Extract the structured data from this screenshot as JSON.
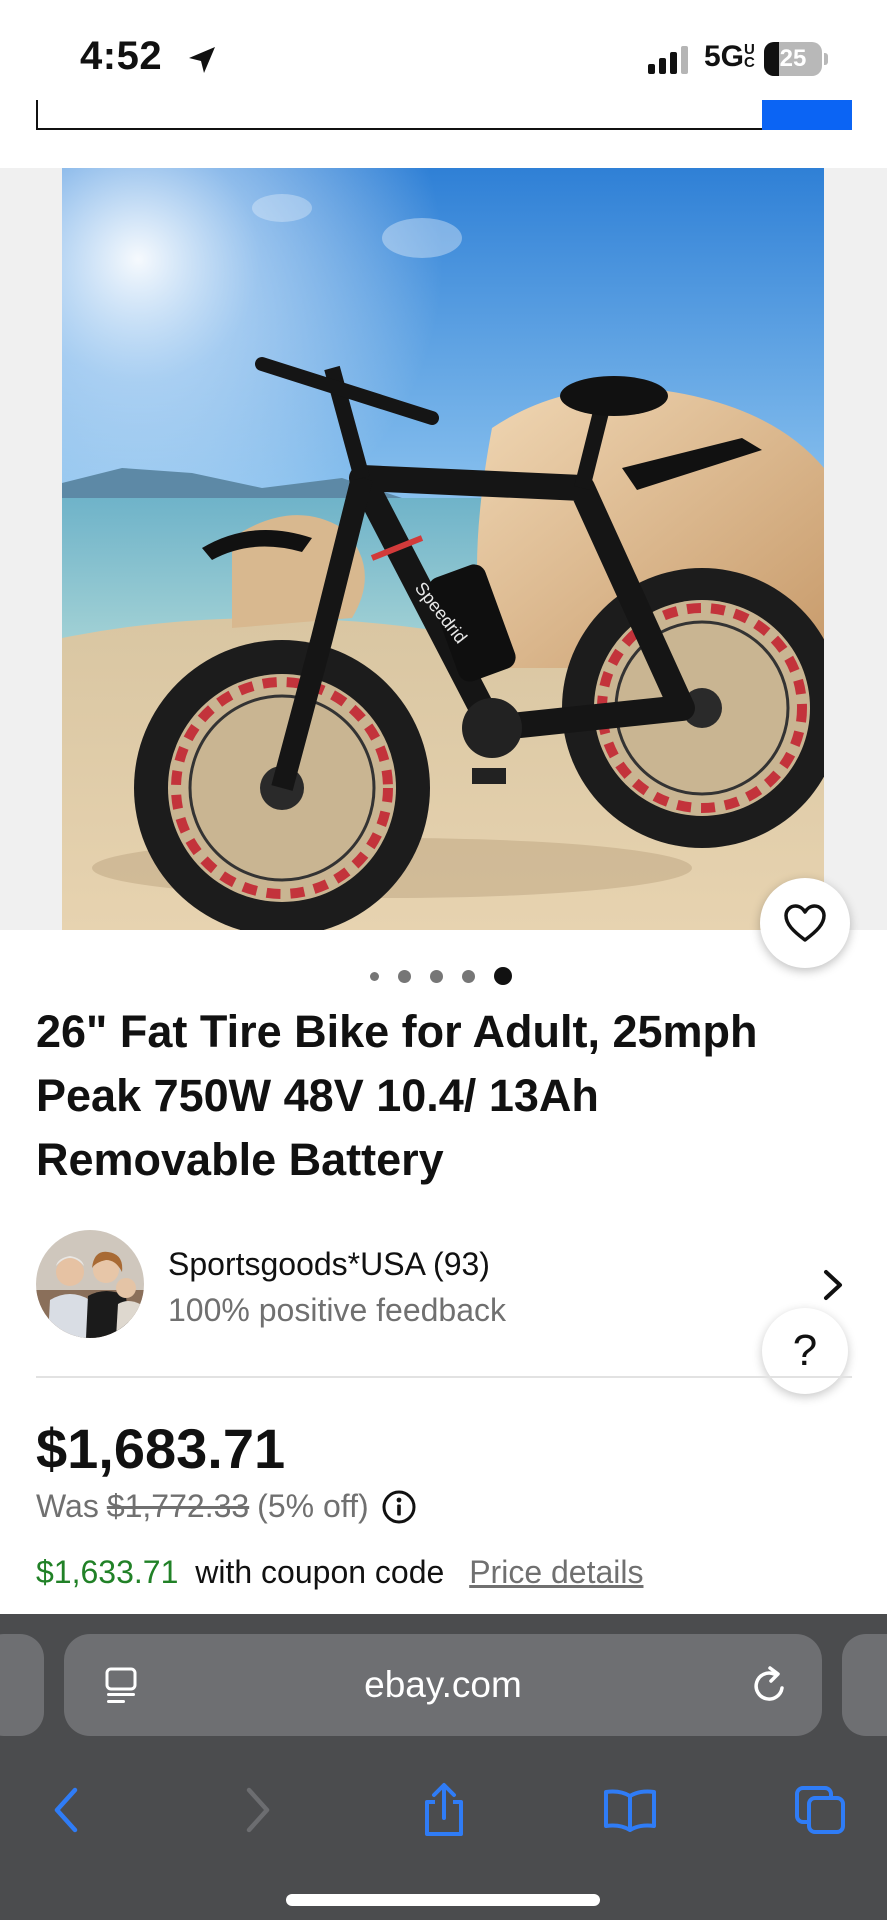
{
  "status_bar": {
    "time": "4:52",
    "network": "5G",
    "network_badge": "UC",
    "battery_level": "25",
    "battery_fraction": 0.25
  },
  "icons": {
    "location": "location-arrow-icon",
    "signal": "signal-bars-icon",
    "heart": "heart-icon",
    "info": "info-icon",
    "chevron": "chevron-right-icon",
    "reader": "reader-mode-icon",
    "reload": "reload-icon",
    "back": "back-arrow-icon",
    "forward": "forward-arrow-icon",
    "share": "share-icon",
    "bookmarks": "bookmarks-icon",
    "tabs": "tabs-icon"
  },
  "gallery": {
    "image_count": 5,
    "active_index": 4
  },
  "product": {
    "title": "26\" Fat Tire Bike for Adult, 25mph Peak 750W 48V 10.4/ 13Ah Removable Battery"
  },
  "seller": {
    "name": "Sportsgoods*USA (93)",
    "feedback": "100% positive feedback"
  },
  "help": {
    "label": "?"
  },
  "pricing": {
    "price": "$1,683.71",
    "was_label": "Was",
    "was_price": "$1,772.33",
    "discount": "(5% off)",
    "coupon_price": "$1,633.71",
    "coupon_text": "with coupon code",
    "price_details": "Price details"
  },
  "browser": {
    "url": "ebay.com"
  },
  "colors": {
    "accent_blue": "#0b64f4",
    "coupon_green": "#218127",
    "safari_blue": "#2f7cf6",
    "safari_bar": "#4b4c4e"
  }
}
